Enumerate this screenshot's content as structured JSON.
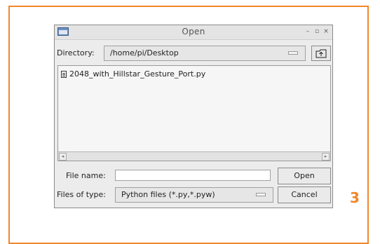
{
  "step_number": "3",
  "dialog": {
    "title": "Open",
    "window_controls": {
      "minimize": "–",
      "maximize": "▫",
      "close": "×"
    },
    "directory_label": "Directory:",
    "directory_value": "/home/pi/Desktop",
    "up_icon": "folder-up-icon",
    "files": [
      {
        "name": "2048_with_Hillstar_Gesture_Port.py",
        "icon": "document-icon"
      }
    ],
    "filename_label": "File name:",
    "filename_value": "",
    "filetype_label": "Files of type:",
    "filetype_value": "Python files (*.py,*.pyw)",
    "open_label": "Open",
    "cancel_label": "Cancel"
  }
}
